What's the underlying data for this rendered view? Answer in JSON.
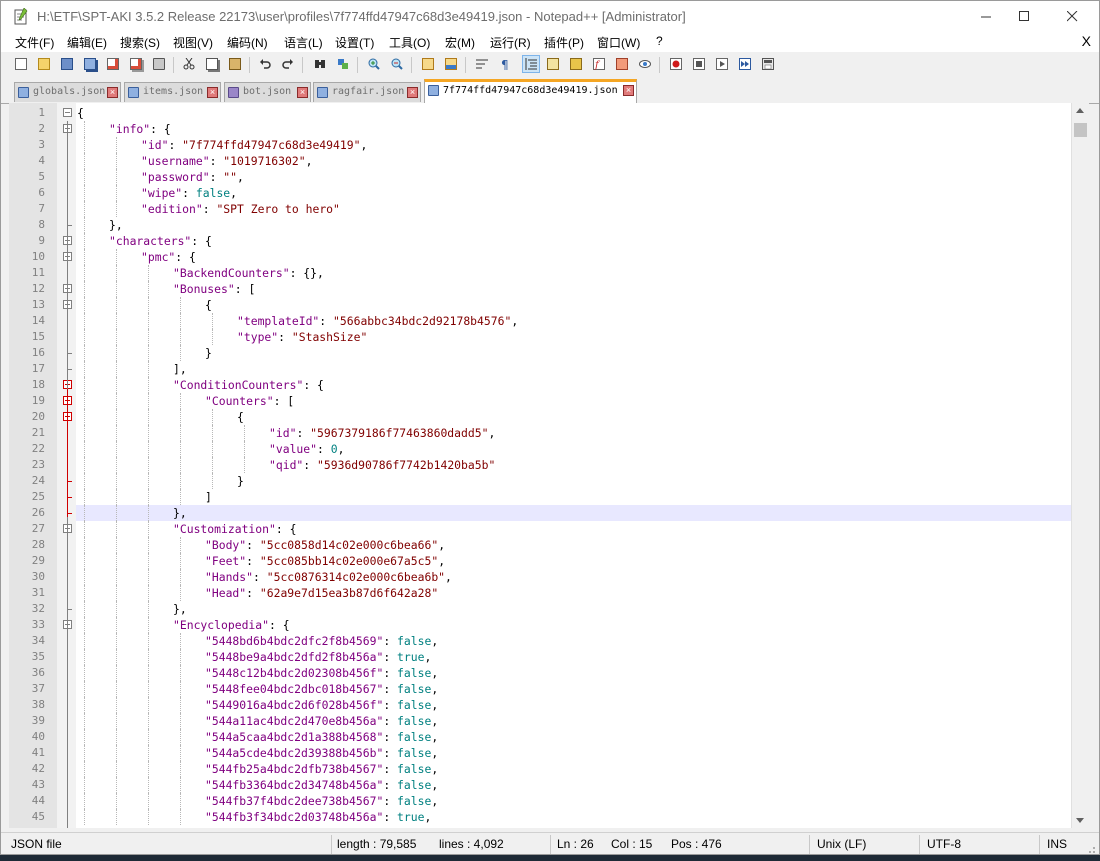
{
  "window": {
    "title": "H:\\ETF\\SPT-AKI 3.5.2 Release 22173\\user\\profiles\\7f774ffd47947c68d3e49419.json - Notepad++ [Administrator]"
  },
  "menu": {
    "items": [
      "文件(F)",
      "编辑(E)",
      "搜索(S)",
      "视图(V)",
      "编码(N)",
      "语言(L)",
      "设置(T)",
      "工具(O)",
      "宏(M)",
      "运行(R)",
      "插件(P)",
      "窗口(W)",
      "?"
    ],
    "close_glyph": "X"
  },
  "toolbar": {
    "buttons": [
      "new-file-icon",
      "open-file-icon",
      "save-icon",
      "save-all-icon",
      "close-icon",
      "close-all-icon",
      "print-icon",
      "cut-icon",
      "copy-icon",
      "paste-icon",
      "undo-icon",
      "redo-icon",
      "find-icon",
      "replace-icon",
      "zoom-in-icon",
      "zoom-out-icon",
      "sync-vertical-icon",
      "sync-horizontal-icon",
      "word-wrap-icon",
      "show-all-characters-icon",
      "indent-guide-icon",
      "user-defined-language-icon",
      "document-map-icon",
      "function-list-icon",
      "folder-as-workspace-icon",
      "monitoring-icon",
      "record-macro-icon",
      "stop-recording-icon",
      "playback-macro-icon",
      "run-macro-multiple-icon",
      "save-macro-icon"
    ]
  },
  "tabs": [
    {
      "label": "globals.json",
      "active": false
    },
    {
      "label": "items.json",
      "active": false
    },
    {
      "label": "bot.json",
      "active": false
    },
    {
      "label": "ragfair.json",
      "active": false
    },
    {
      "label": "7f774ffd47947c68d3e49419.json",
      "active": true
    }
  ],
  "editor": {
    "first_line_number": 1,
    "current_line": 26,
    "lines": [
      {
        "indent": 0,
        "segs": [
          [
            "punc",
            "{"
          ]
        ]
      },
      {
        "indent": 1,
        "segs": [
          [
            "key",
            "\"info\""
          ],
          [
            "punc",
            ": {"
          ]
        ]
      },
      {
        "indent": 2,
        "segs": [
          [
            "key",
            "\"id\""
          ],
          [
            "punc",
            ": "
          ],
          [
            "str",
            "\"7f774ffd47947c68d3e49419\""
          ],
          [
            "punc",
            ","
          ]
        ]
      },
      {
        "indent": 2,
        "segs": [
          [
            "key",
            "\"username\""
          ],
          [
            "punc",
            ": "
          ],
          [
            "str",
            "\"1019716302\""
          ],
          [
            "punc",
            ","
          ]
        ]
      },
      {
        "indent": 2,
        "segs": [
          [
            "key",
            "\"password\""
          ],
          [
            "punc",
            ": "
          ],
          [
            "str",
            "\"\""
          ],
          [
            "punc",
            ","
          ]
        ]
      },
      {
        "indent": 2,
        "segs": [
          [
            "key",
            "\"wipe\""
          ],
          [
            "punc",
            ": "
          ],
          [
            "lit",
            "false"
          ],
          [
            "punc",
            ","
          ]
        ]
      },
      {
        "indent": 2,
        "segs": [
          [
            "key",
            "\"edition\""
          ],
          [
            "punc",
            ": "
          ],
          [
            "str",
            "\"SPT Zero to hero\""
          ]
        ]
      },
      {
        "indent": 1,
        "segs": [
          [
            "punc",
            "},"
          ]
        ]
      },
      {
        "indent": 1,
        "segs": [
          [
            "key",
            "\"characters\""
          ],
          [
            "punc",
            ": {"
          ]
        ]
      },
      {
        "indent": 2,
        "segs": [
          [
            "key",
            "\"pmc\""
          ],
          [
            "punc",
            ": {"
          ]
        ]
      },
      {
        "indent": 3,
        "segs": [
          [
            "key",
            "\"BackendCounters\""
          ],
          [
            "punc",
            ": {},"
          ]
        ]
      },
      {
        "indent": 3,
        "segs": [
          [
            "key",
            "\"Bonuses\""
          ],
          [
            "punc",
            ": ["
          ]
        ]
      },
      {
        "indent": 4,
        "segs": [
          [
            "punc",
            "{"
          ]
        ]
      },
      {
        "indent": 5,
        "segs": [
          [
            "key",
            "\"templateId\""
          ],
          [
            "punc",
            ": "
          ],
          [
            "str",
            "\"566abbc34bdc2d92178b4576\""
          ],
          [
            "punc",
            ","
          ]
        ]
      },
      {
        "indent": 5,
        "segs": [
          [
            "key",
            "\"type\""
          ],
          [
            "punc",
            ": "
          ],
          [
            "str",
            "\"StashSize\""
          ]
        ]
      },
      {
        "indent": 4,
        "segs": [
          [
            "punc",
            "}"
          ]
        ]
      },
      {
        "indent": 3,
        "segs": [
          [
            "punc",
            "],"
          ]
        ]
      },
      {
        "indent": 3,
        "segs": [
          [
            "key",
            "\"ConditionCounters\""
          ],
          [
            "punc",
            ": {"
          ]
        ]
      },
      {
        "indent": 4,
        "segs": [
          [
            "key",
            "\"Counters\""
          ],
          [
            "punc",
            ": ["
          ]
        ]
      },
      {
        "indent": 5,
        "segs": [
          [
            "punc",
            "{"
          ]
        ]
      },
      {
        "indent": 6,
        "segs": [
          [
            "key",
            "\"id\""
          ],
          [
            "punc",
            ": "
          ],
          [
            "str",
            "\"5967379186f77463860dadd5\""
          ],
          [
            "punc",
            ","
          ]
        ]
      },
      {
        "indent": 6,
        "segs": [
          [
            "key",
            "\"value\""
          ],
          [
            "punc",
            ": "
          ],
          [
            "lit",
            "0"
          ],
          [
            "punc",
            ","
          ]
        ]
      },
      {
        "indent": 6,
        "segs": [
          [
            "key",
            "\"qid\""
          ],
          [
            "punc",
            ": "
          ],
          [
            "str",
            "\"5936d90786f7742b1420ba5b\""
          ]
        ]
      },
      {
        "indent": 5,
        "segs": [
          [
            "punc",
            "}"
          ]
        ]
      },
      {
        "indent": 4,
        "segs": [
          [
            "punc",
            "]"
          ]
        ]
      },
      {
        "indent": 3,
        "segs": [
          [
            "punc",
            "},"
          ]
        ]
      },
      {
        "indent": 3,
        "segs": [
          [
            "key",
            "\"Customization\""
          ],
          [
            "punc",
            ": {"
          ]
        ]
      },
      {
        "indent": 4,
        "segs": [
          [
            "key",
            "\"Body\""
          ],
          [
            "punc",
            ": "
          ],
          [
            "str",
            "\"5cc0858d14c02e000c6bea66\""
          ],
          [
            "punc",
            ","
          ]
        ]
      },
      {
        "indent": 4,
        "segs": [
          [
            "key",
            "\"Feet\""
          ],
          [
            "punc",
            ": "
          ],
          [
            "str",
            "\"5cc085bb14c02e000e67a5c5\""
          ],
          [
            "punc",
            ","
          ]
        ]
      },
      {
        "indent": 4,
        "segs": [
          [
            "key",
            "\"Hands\""
          ],
          [
            "punc",
            ": "
          ],
          [
            "str",
            "\"5cc0876314c02e000c6bea6b\""
          ],
          [
            "punc",
            ","
          ]
        ]
      },
      {
        "indent": 4,
        "segs": [
          [
            "key",
            "\"Head\""
          ],
          [
            "punc",
            ": "
          ],
          [
            "str",
            "\"62a9e7d15ea3b87d6f642a28\""
          ]
        ]
      },
      {
        "indent": 3,
        "segs": [
          [
            "punc",
            "},"
          ]
        ]
      },
      {
        "indent": 3,
        "segs": [
          [
            "key",
            "\"Encyclopedia\""
          ],
          [
            "punc",
            ": {"
          ]
        ]
      },
      {
        "indent": 4,
        "segs": [
          [
            "key",
            "\"5448bd6b4bdc2dfc2f8b4569\""
          ],
          [
            "punc",
            ": "
          ],
          [
            "lit",
            "false"
          ],
          [
            "punc",
            ","
          ]
        ]
      },
      {
        "indent": 4,
        "segs": [
          [
            "key",
            "\"5448be9a4bdc2dfd2f8b456a\""
          ],
          [
            "punc",
            ": "
          ],
          [
            "lit",
            "true"
          ],
          [
            "punc",
            ","
          ]
        ]
      },
      {
        "indent": 4,
        "segs": [
          [
            "key",
            "\"5448c12b4bdc2d02308b456f\""
          ],
          [
            "punc",
            ": "
          ],
          [
            "lit",
            "false"
          ],
          [
            "punc",
            ","
          ]
        ]
      },
      {
        "indent": 4,
        "segs": [
          [
            "key",
            "\"5448fee04bdc2dbc018b4567\""
          ],
          [
            "punc",
            ": "
          ],
          [
            "lit",
            "false"
          ],
          [
            "punc",
            ","
          ]
        ]
      },
      {
        "indent": 4,
        "segs": [
          [
            "key",
            "\"5449016a4bdc2d6f028b456f\""
          ],
          [
            "punc",
            ": "
          ],
          [
            "lit",
            "false"
          ],
          [
            "punc",
            ","
          ]
        ]
      },
      {
        "indent": 4,
        "segs": [
          [
            "key",
            "\"544a11ac4bdc2d470e8b456a\""
          ],
          [
            "punc",
            ": "
          ],
          [
            "lit",
            "false"
          ],
          [
            "punc",
            ","
          ]
        ]
      },
      {
        "indent": 4,
        "segs": [
          [
            "key",
            "\"544a5caa4bdc2d1a388b4568\""
          ],
          [
            "punc",
            ": "
          ],
          [
            "lit",
            "false"
          ],
          [
            "punc",
            ","
          ]
        ]
      },
      {
        "indent": 4,
        "segs": [
          [
            "key",
            "\"544a5cde4bdc2d39388b456b\""
          ],
          [
            "punc",
            ": "
          ],
          [
            "lit",
            "false"
          ],
          [
            "punc",
            ","
          ]
        ]
      },
      {
        "indent": 4,
        "segs": [
          [
            "key",
            "\"544fb25a4bdc2dfb738b4567\""
          ],
          [
            "punc",
            ": "
          ],
          [
            "lit",
            "false"
          ],
          [
            "punc",
            ","
          ]
        ]
      },
      {
        "indent": 4,
        "segs": [
          [
            "key",
            "\"544fb3364bdc2d34748b456a\""
          ],
          [
            "punc",
            ": "
          ],
          [
            "lit",
            "false"
          ],
          [
            "punc",
            ","
          ]
        ]
      },
      {
        "indent": 4,
        "segs": [
          [
            "key",
            "\"544fb37f4bdc2dee738b4567\""
          ],
          [
            "punc",
            ": "
          ],
          [
            "lit",
            "false"
          ],
          [
            "punc",
            ","
          ]
        ]
      },
      {
        "indent": 4,
        "segs": [
          [
            "key",
            "\"544fb3f34bdc2d03748b456a\""
          ],
          [
            "punc",
            ": "
          ],
          [
            "lit",
            "true"
          ],
          [
            "punc",
            ","
          ]
        ]
      }
    ],
    "fold_open_lines": [
      1,
      2,
      9,
      10,
      12,
      13,
      18,
      19,
      20,
      27,
      33
    ],
    "fold_highlight_lines": [
      18,
      19,
      20
    ]
  },
  "statusbar": {
    "file_type": "JSON file",
    "length": "length : 79,585",
    "lines": "lines : 4,092",
    "ln": "Ln : 26",
    "col": "Col : 15",
    "pos": "Pos : 476",
    "eol": "Unix (LF)",
    "encoding": "UTF-8",
    "mode": "INS"
  },
  "colors": {
    "key": "#800080",
    "string": "#800000",
    "literal": "#008080",
    "current_line": "#e8e8ff",
    "active_tab_accent": "#f5a623"
  }
}
